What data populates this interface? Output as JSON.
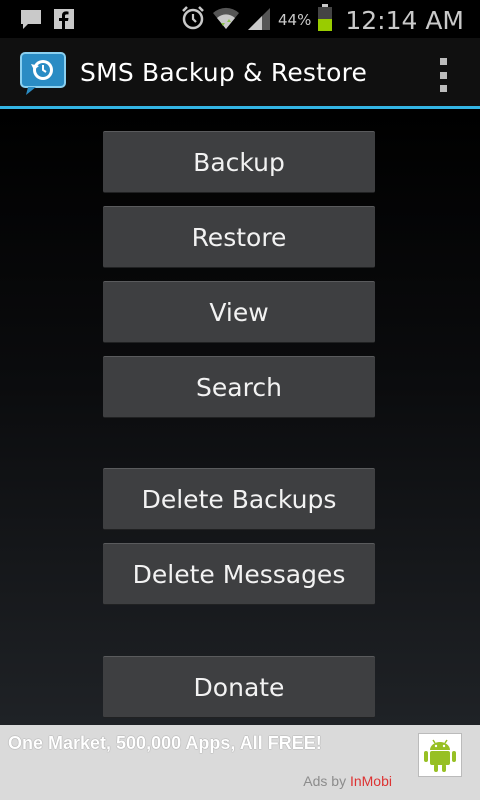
{
  "status_bar": {
    "battery_percent": "44%",
    "time": "12:14 AM",
    "icons": [
      "message-icon",
      "facebook-icon",
      "alarm-icon",
      "wifi-icon",
      "signal-icon",
      "battery-icon"
    ]
  },
  "action_bar": {
    "title": "SMS Backup & Restore",
    "accent_color": "#33b5e5"
  },
  "buttons": [
    {
      "id": "backup",
      "label": "Backup"
    },
    {
      "id": "restore",
      "label": "Restore"
    },
    {
      "id": "view",
      "label": "View"
    },
    {
      "id": "search",
      "label": "Search"
    },
    {
      "id": "delete-backups",
      "label": "Delete Backups"
    },
    {
      "id": "delete-messages",
      "label": "Delete Messages"
    },
    {
      "id": "donate",
      "label": "Donate"
    }
  ],
  "ad": {
    "text": "One Market, 500,000 Apps, All FREE!",
    "by_prefix": "Ads by ",
    "by_brand": "InMobi"
  }
}
